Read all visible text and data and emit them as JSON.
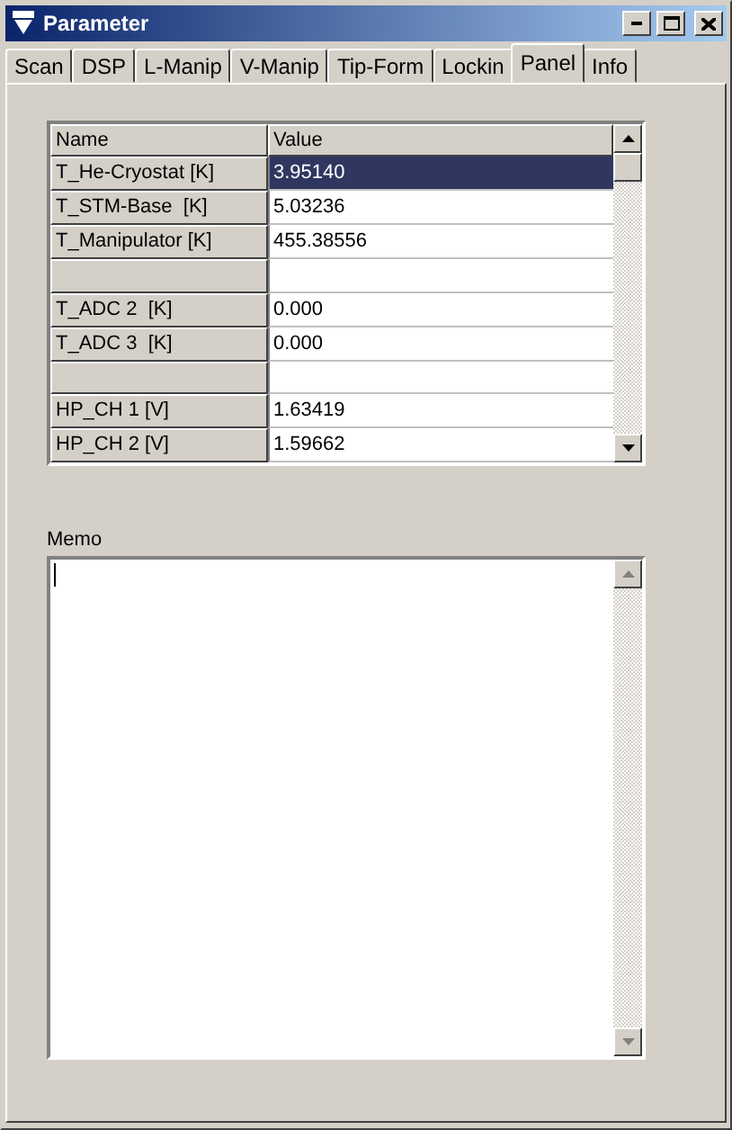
{
  "window": {
    "title": "Parameter"
  },
  "tabs": [
    {
      "label": "Scan",
      "selected": false
    },
    {
      "label": "DSP",
      "selected": false
    },
    {
      "label": "L-Manip",
      "selected": false
    },
    {
      "label": "V-Manip",
      "selected": false
    },
    {
      "label": "Tip-Form",
      "selected": false
    },
    {
      "label": "Lockin",
      "selected": false
    },
    {
      "label": "Panel",
      "selected": true
    },
    {
      "label": "Info",
      "selected": false
    }
  ],
  "table": {
    "columns": [
      "Name",
      "Value"
    ],
    "rows": [
      {
        "name": "T_He-Cryostat [K]",
        "value": "3.95140",
        "selected": true
      },
      {
        "name": "T_STM-Base  [K]",
        "value": "5.03236",
        "selected": false
      },
      {
        "name": "T_Manipulator [K]",
        "value": "455.38556",
        "selected": false
      },
      {
        "selected": false
      },
      {
        "name": "T_ADC 2  [K]",
        "value": "0.000",
        "selected": false
      },
      {
        "name": "T_ADC 3  [K]",
        "value": "0.000",
        "selected": false
      },
      {
        "selected": false
      },
      {
        "name": "HP_CH 1 [V]",
        "value": "1.63419",
        "selected": false
      },
      {
        "name": "HP_CH 2 [V]",
        "value": "1.59662",
        "selected": false
      }
    ]
  },
  "memo": {
    "label": "Memo"
  }
}
